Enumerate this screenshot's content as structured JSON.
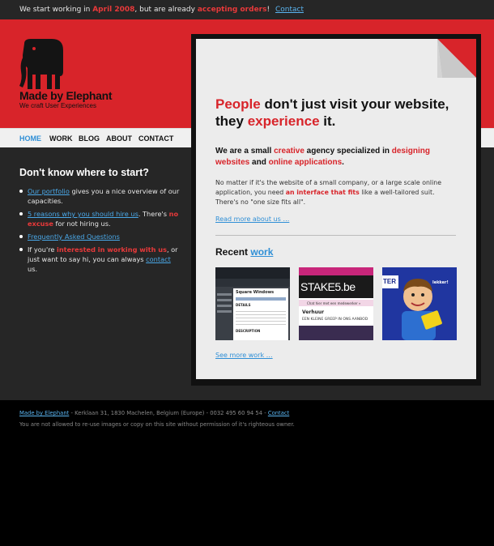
{
  "topbar": {
    "pre": "We start working in ",
    "date": "April 2008",
    "mid": ", but are already ",
    "accepting": "accepting orders",
    "bang": "!",
    "contact": "Contact"
  },
  "logo": {
    "name": "Made by Elephant",
    "tagline": "We craft User Experiences"
  },
  "nav": {
    "home": "HOME",
    "work": "WORK",
    "blog": "BLOG",
    "about": "ABOUT",
    "contact": "CONTACT"
  },
  "sidebar": {
    "title": "Don't know where to start?",
    "item1": {
      "link": "Our portfolio",
      "text": " gives you a nice overview of our capacities."
    },
    "item2": {
      "link": "5 reasons why you should hire us",
      "mid": ". There's ",
      "red": "no excuse",
      "text": " for not hiring us."
    },
    "item3": {
      "link": "Frequently Asked Questions"
    },
    "item4": {
      "pre": "If you're ",
      "red": "interested in working with us",
      "mid": ", or just want to say hi, you can always ",
      "link": "contact",
      "post": " us."
    }
  },
  "main": {
    "headline": {
      "p1": "People",
      "p2": " don't just visit your website, they ",
      "p3": "experience",
      "p4": " it."
    },
    "intro": {
      "p1": "We are a small ",
      "p2": "creative",
      "p3": " agency specialized in ",
      "p4": "designing websites",
      "p5": " and ",
      "p6": "online applications",
      "p7": "."
    },
    "body": {
      "p1": "No matter if it's the website of a small company, or a large scale online application, you need ",
      "p2": "an interface that fits",
      "p3": " like a well-tailored suit. There's no \"one size fits all\"."
    },
    "read_more": "Read more about us …",
    "recent_label": "Recent ",
    "recent_link": "work",
    "see_more": "See more work …",
    "thumbs": {
      "t1": {
        "heading": "Square Windows",
        "subheading": "DETAILS",
        "desc": "DESCRIPTION"
      },
      "t2": {
        "brand": "STAKE5.be",
        "chat": "Chat hier met een medewerker »",
        "section": "Verhuur",
        "tagline": "EEN KLEINE GREEP IN ONS AANBOD"
      },
      "t3": {
        "label": "TER",
        "bubble": "lekker!"
      }
    }
  },
  "footer": {
    "company": "Made by Elephant",
    "address": " - Kerklaan 31, 1830 Machelen, Belgium (Europe) - 0032 495 60 94 54 - ",
    "contact": "Contact",
    "note": "You are not allowed to re-use images or copy on this site without permission of it's righteous owner."
  },
  "colors": {
    "brand_red": "#d8242a",
    "link_blue": "#2f8fd6",
    "dark_bg": "#262626"
  }
}
